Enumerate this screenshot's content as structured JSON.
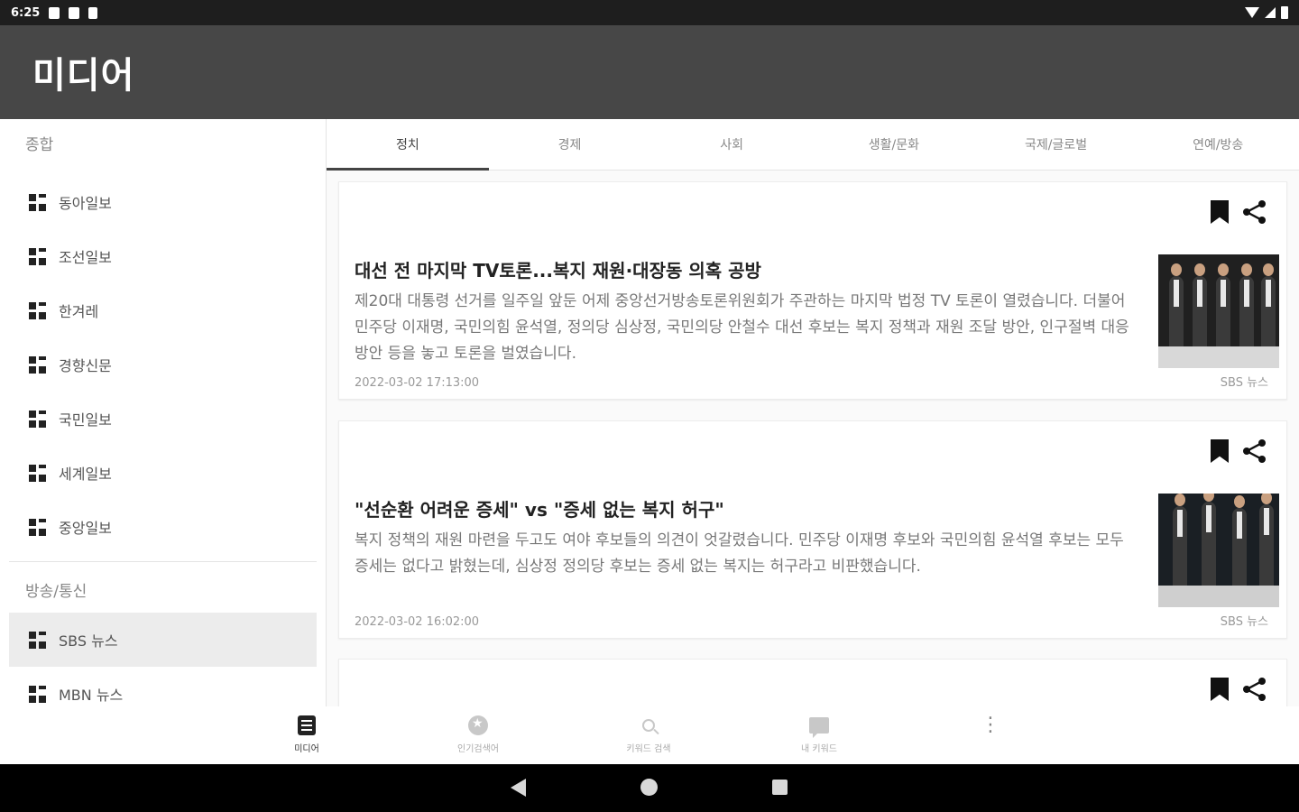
{
  "status_bar": {
    "time": "6:25",
    "icons": [
      "notification-icon",
      "sd-card-icon",
      "clipboard-icon"
    ],
    "right_icons": [
      "wifi-icon",
      "signal-icon",
      "battery-icon"
    ]
  },
  "app_bar": {
    "title": "미디어"
  },
  "sidebar": {
    "sections": [
      {
        "title": "종합",
        "items": [
          "동아일보",
          "조선일보",
          "한겨레",
          "경향신문",
          "국민일보",
          "세계일보",
          "중앙일보"
        ]
      },
      {
        "title": "방송/통신",
        "items": [
          "SBS 뉴스",
          "MBN 뉴스"
        ]
      }
    ],
    "selected": "SBS 뉴스"
  },
  "tabs": {
    "items": [
      "정치",
      "경제",
      "사회",
      "생활/문화",
      "국제/글로벌",
      "연예/방송"
    ],
    "selected": "정치"
  },
  "articles": [
    {
      "headline": "대선 전 마지막 TV토론...복지 재원·대장동 의혹 공방",
      "summary": "제20대 대통령 선거를 일주일 앞둔 어제 중앙선거방송토론위원회가 주관하는 마지막 법정 TV 토론이 열렸습니다. 더불어민주당 이재명, 국민의힘 윤석열, 정의당 심상정, 국민의당 안철수 대선 후보는 복지 정책과 재원 조달 방안, 인구절벽 대응 방안 등을 놓고 토론을 벌였습니다.",
      "date": "2022-03-02 17:13:00",
      "source": "SBS 뉴스"
    },
    {
      "headline": "\"선순환 어려운 증세\" vs \"증세 없는 복지 허구\"",
      "summary": "복지 정책의 재원 마련을 두고도 여야 후보들의 의견이 엇갈렸습니다. 민주당 이재명 후보와 국민의힘 윤석열 후보는 모두 증세는 없다고 밝혔는데, 심상정 정의당 후보는 증세 없는 복지는 허구라고 비판했습니다.",
      "date": "2022-03-02 16:02:00",
      "source": "SBS 뉴스"
    }
  ],
  "bottom_nav": {
    "items": [
      {
        "label": "미디어",
        "icon": "article-icon"
      },
      {
        "label": "인기검색어",
        "icon": "star-icon"
      },
      {
        "label": "키워드 검색",
        "icon": "search-icon"
      },
      {
        "label": "내 키워드",
        "icon": "chat-icon"
      }
    ],
    "selected": "미디어",
    "more_icon": "more-vert-icon"
  },
  "system_nav": {
    "icons": [
      "back-icon",
      "home-icon",
      "recent-apps-icon"
    ]
  },
  "colors": {
    "app_bar": "#474747",
    "status_bar": "#1e1e1e",
    "selected_item": "#ececec"
  }
}
